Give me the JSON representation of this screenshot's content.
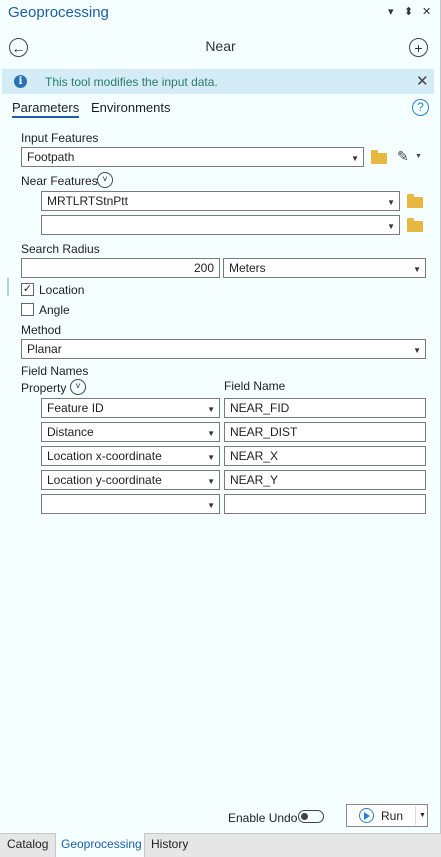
{
  "pane": {
    "title": "Geoprocessing",
    "pin_icon": "⬍",
    "close_icon": "✕",
    "menu_icon": "▾"
  },
  "tool": {
    "title": "Near"
  },
  "info": {
    "message": "This tool modifies the input data.",
    "icon_glyph": "i"
  },
  "tabs": {
    "parameters": "Parameters",
    "environments": "Environments",
    "help_glyph": "?"
  },
  "params": {
    "input_features": {
      "label": "Input Features",
      "value": "Footpath"
    },
    "near_features": {
      "label": "Near Features",
      "rows": [
        "MRTLRTStnPtt",
        ""
      ]
    },
    "search_radius": {
      "label": "Search Radius",
      "value": "200",
      "unit": "Meters"
    },
    "location": {
      "label": "Location",
      "checked": true,
      "check_glyph": "✓"
    },
    "angle": {
      "label": "Angle",
      "checked": false
    },
    "method": {
      "label": "Method",
      "value": "Planar"
    },
    "field_names": {
      "label": "Field Names",
      "property_header": "Property",
      "field_header": "Field Name",
      "rows": [
        {
          "property": "Feature ID",
          "field": "NEAR_FID"
        },
        {
          "property": "Distance",
          "field": "NEAR_DIST"
        },
        {
          "property": "Location x-coordinate",
          "field": "NEAR_X"
        },
        {
          "property": "Location y-coordinate",
          "field": "NEAR_Y"
        },
        {
          "property": "",
          "field": ""
        }
      ]
    }
  },
  "footer": {
    "enable_undo": "Enable Undo",
    "run": "Run"
  },
  "bottom_tabs": [
    "Catalog",
    "Geoprocessing",
    "History"
  ],
  "colors": {
    "accent": "#1a5fa8",
    "info_bg": "#d4ecf5",
    "info_text": "#2c7a6b",
    "folder": "#e8b73f",
    "pane_bg": "#f6ffff"
  }
}
